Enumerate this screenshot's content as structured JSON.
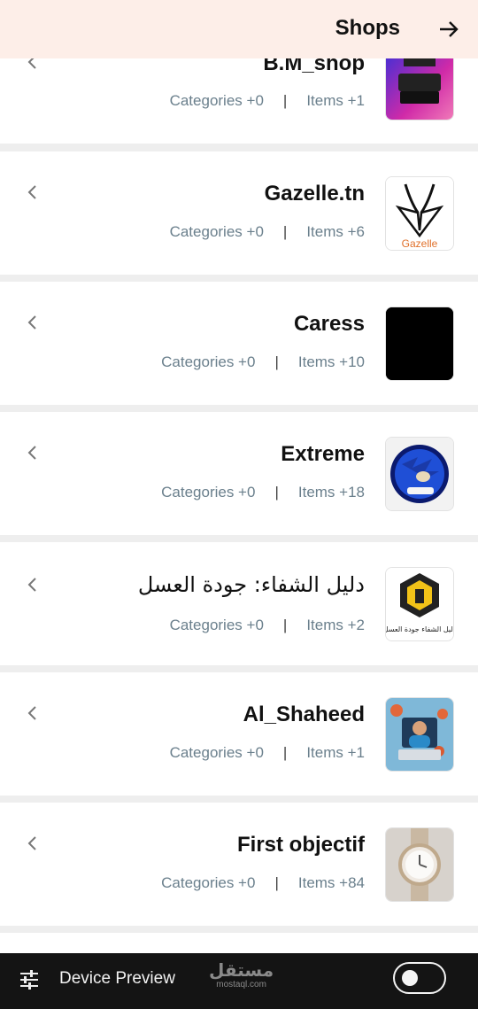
{
  "header": {
    "title": "Shops"
  },
  "shops": [
    {
      "name": "B.M_shop",
      "categories": "Categories +0",
      "items": "Items +1",
      "thumb_icon": "bm-shop-logo"
    },
    {
      "name": "Gazelle.tn",
      "categories": "Categories +0",
      "items": "Items +6",
      "thumb_icon": "gazelle-logo",
      "thumb_text": "Gazelle"
    },
    {
      "name": "Caress",
      "categories": "Categories +0",
      "items": "Items +10",
      "thumb_icon": "black-square"
    },
    {
      "name": "Extreme",
      "categories": "Categories +0",
      "items": "Items +18",
      "thumb_icon": "sonic-avatar"
    },
    {
      "name": "دليل الشفاء: جودة العسل",
      "categories": "Categories +0",
      "items": "Items +2",
      "thumb_icon": "honey-bee-logo",
      "thumb_text": "دليل الشفاء جودة العسل"
    },
    {
      "name": "Al_Shaheed",
      "categories": "Categories +0",
      "items": "Items +1",
      "thumb_icon": "developer-avatar"
    },
    {
      "name": "First objectif",
      "categories": "Categories +0",
      "items": "Items +84",
      "thumb_icon": "watch-photo"
    }
  ],
  "bottom_bar": {
    "label": "Device Preview",
    "watermark_ar": "مستقل",
    "watermark_en": "mostaql.com",
    "toggle_on": false
  },
  "colors": {
    "header_bg": "#fdeee8",
    "meta_text": "#6a7f8c",
    "bottom_bar_bg": "#141414"
  }
}
